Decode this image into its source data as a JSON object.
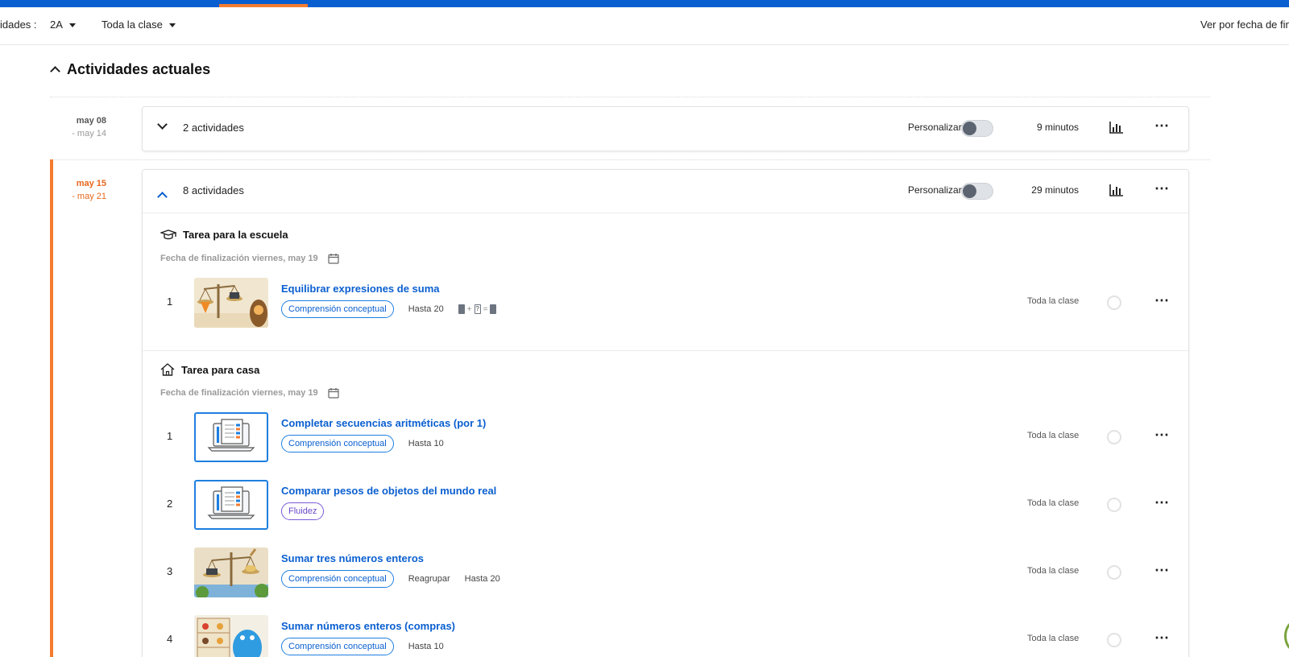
{
  "filters": {
    "activities_label": "idades :",
    "group": "2A",
    "audience": "Toda la clase",
    "sort": "Ver por fecha de fin"
  },
  "section": {
    "title": "Actividades actuales"
  },
  "weeks": [
    {
      "start": "may 08",
      "end": "- may 14",
      "count": "2 actividades",
      "personalize_label": "Personalizar",
      "minutes": "9 minutos",
      "expanded": false
    },
    {
      "start": "may 15",
      "end": "- may 21",
      "count": "8 actividades",
      "personalize_label": "Personalizar",
      "minutes": "29 minutos",
      "expanded": true,
      "groups": [
        {
          "title": "Tarea para la escuela",
          "icon": "graduation-cap-icon",
          "due": "Fecha de finalización viernes, may 19",
          "items": [
            {
              "num": "1",
              "title": "Equilibrar expresiones de suma",
              "tag": "Comprensión conceptual",
              "meta1": "Hasta 20",
              "meta2": "",
              "who": "Toda la clase",
              "formula_plus": "+",
              "formula_q": "?",
              "formula_eq": "="
            }
          ]
        },
        {
          "title": "Tarea para casa",
          "icon": "house-icon",
          "due": "Fecha de finalización viernes, may 19",
          "items": [
            {
              "num": "1",
              "title": "Completar secuencias aritméticas (por 1)",
              "tag": "Comprensión conceptual",
              "meta1": "Hasta 10",
              "meta2": "",
              "who": "Toda la clase"
            },
            {
              "num": "2",
              "title": "Comparar pesos de objetos del mundo real",
              "tag": "Fluidez",
              "meta1": "",
              "meta2": "",
              "who": "Toda la clase"
            },
            {
              "num": "3",
              "title": "Sumar tres números enteros",
              "tag": "Comprensión conceptual",
              "meta1": "Reagrupar",
              "meta2": "Hasta 20",
              "who": "Toda la clase"
            },
            {
              "num": "4",
              "title": "Sumar números enteros (compras)",
              "tag": "Comprensión conceptual",
              "meta1": "Hasta 10",
              "meta2": "",
              "who": "Toda la clase"
            }
          ]
        }
      ]
    }
  ],
  "colors": {
    "brand_blue": "#0a5fd0",
    "accent_orange": "#f47c30"
  }
}
